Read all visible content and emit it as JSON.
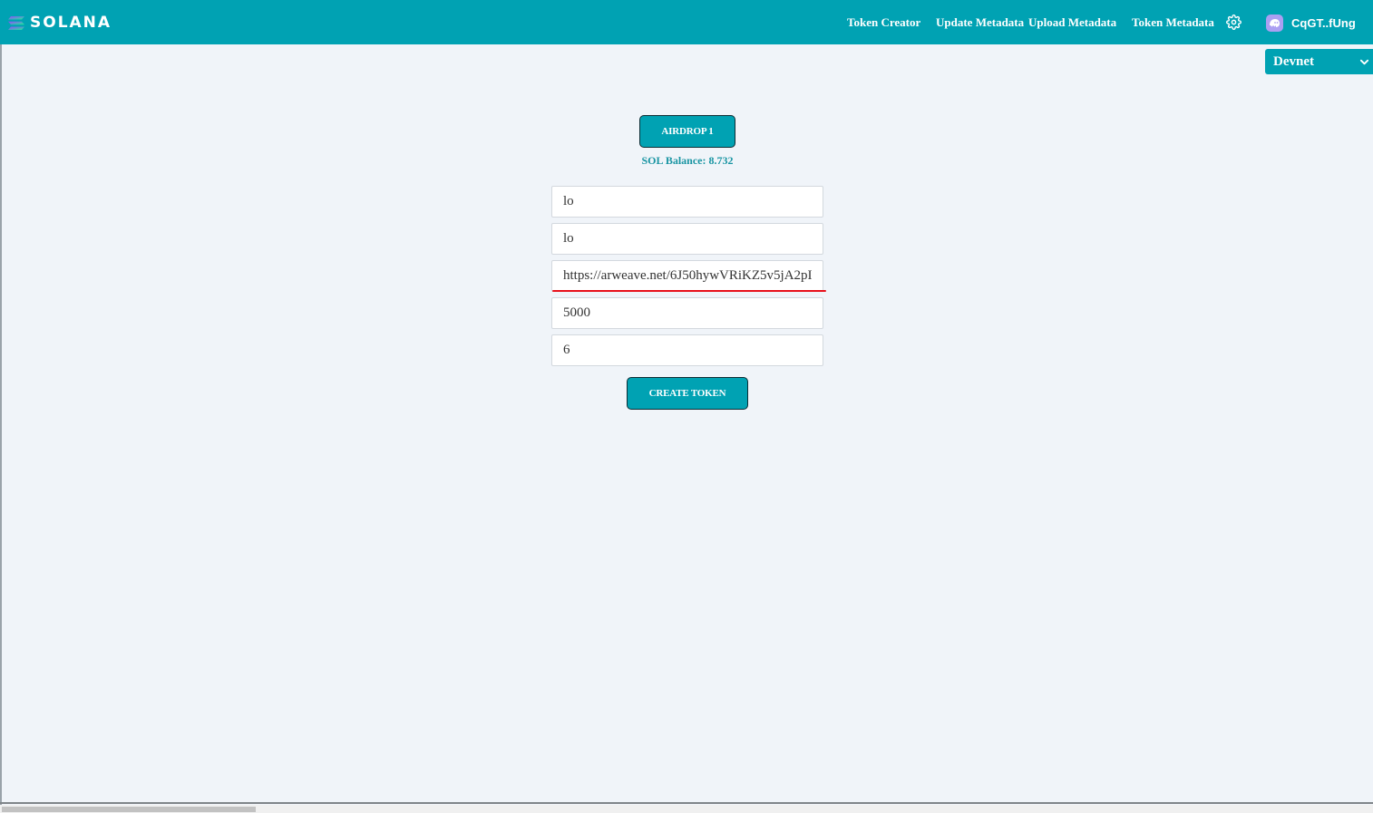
{
  "brand": {
    "name": "SOLANA",
    "icon": "solana-logo-icon"
  },
  "nav": {
    "links": [
      {
        "label": "Token Creator"
      },
      {
        "label": "Update Metadata"
      },
      {
        "label": "Upload Metadata"
      },
      {
        "label": "Token Metadata"
      }
    ],
    "settings_icon": "gear-icon",
    "wallet": {
      "label": "CqGT..fUng",
      "icon": "phantom-wallet-icon"
    }
  },
  "network": {
    "selected": "Devnet",
    "icon": "chevron-down-icon"
  },
  "airdrop": {
    "label": "AIRDROP 1"
  },
  "balance": {
    "text": "SOL Balance: 8.732"
  },
  "form": {
    "fields": [
      {
        "value": "lo"
      },
      {
        "value": "lo"
      },
      {
        "value": "https://arweave.net/6J50hywVRiKZ5v5jA2pI"
      },
      {
        "value": "5000"
      },
      {
        "value": "6"
      }
    ],
    "submit_label": "CREATE TOKEN"
  },
  "colors": {
    "accent": "#00a2b3",
    "background": "#f0f4f9",
    "highlight_underline": "#e8101a",
    "wallet_icon": "#ab9ff2"
  }
}
